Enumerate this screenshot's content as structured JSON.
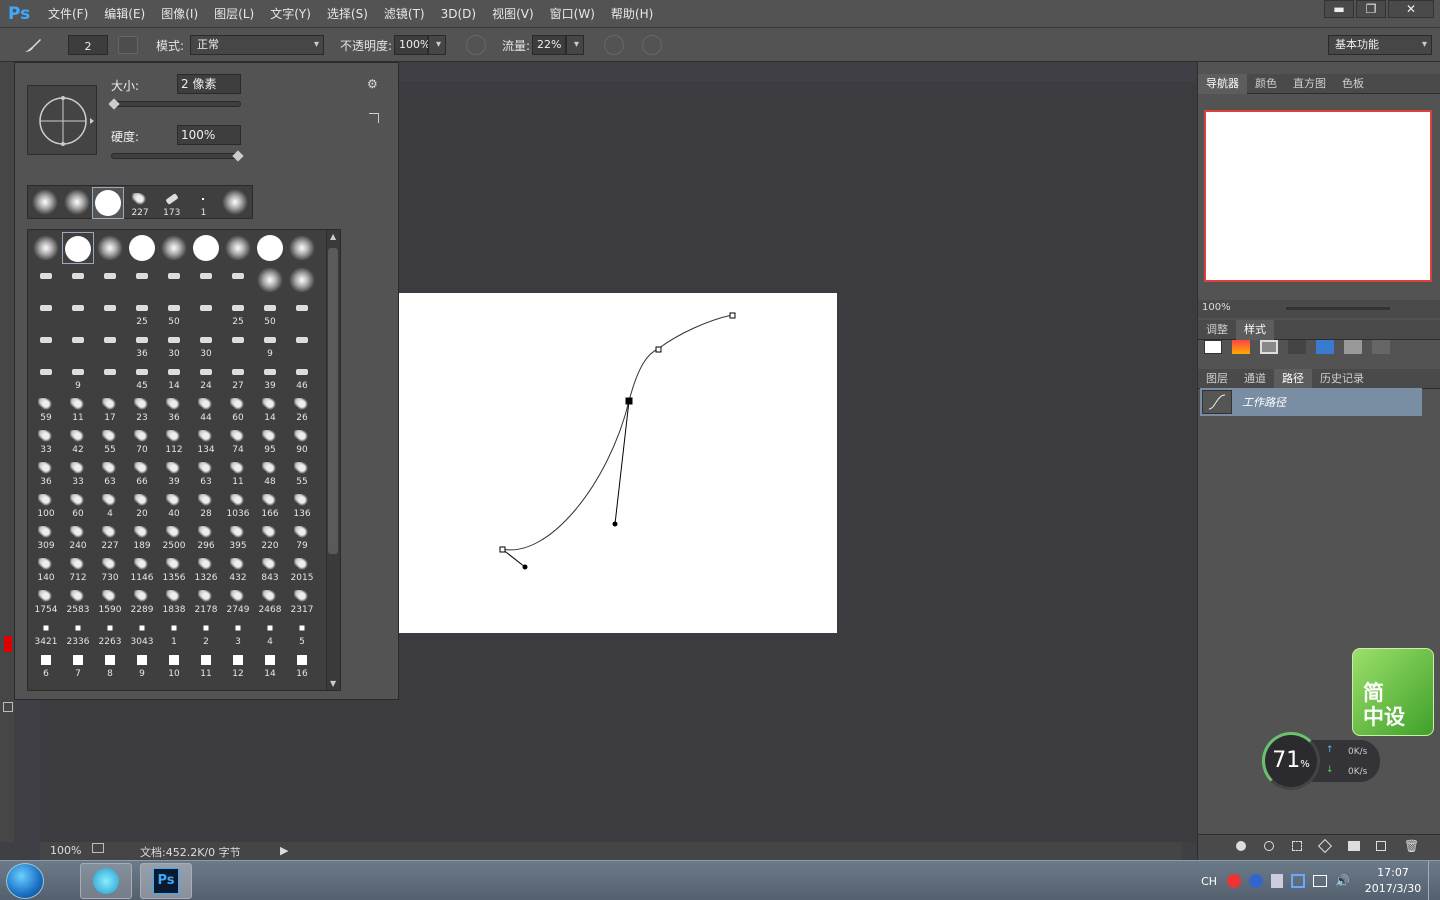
{
  "app": {
    "logo": "Ps"
  },
  "menu": [
    "文件(F)",
    "编辑(E)",
    "图像(I)",
    "图层(L)",
    "文字(Y)",
    "选择(S)",
    "滤镜(T)",
    "3D(D)",
    "视图(V)",
    "窗口(W)",
    "帮助(H)"
  ],
  "window_controls": {
    "minimize": "▬",
    "restore": "❐",
    "close": "✕"
  },
  "options": {
    "brush_size": "2",
    "mode_label": "模式:",
    "mode_value": "正常",
    "opacity_label": "不透明度:",
    "opacity_value": "100%",
    "flow_label": "流量:",
    "flow_value": "22%",
    "workspace": "基本功能"
  },
  "brush_panel": {
    "size_label": "大小:",
    "size_value": "2 像素",
    "hardness_label": "硬度:",
    "hardness_value": "100%",
    "size_fraction": 0.01,
    "hardness_fraction": 1.0,
    "recent_numbers": [
      "",
      "",
      "",
      "227",
      "173",
      "1",
      ""
    ],
    "grid_numbers": [
      "",
      "",
      "",
      "",
      "",
      "",
      "",
      "",
      "",
      "",
      "",
      "",
      "",
      "",
      "",
      "",
      "",
      "",
      "",
      "",
      "",
      "25",
      "50",
      "",
      "25",
      "50",
      "",
      "",
      "",
      "",
      "36",
      "30",
      "30",
      "",
      "9",
      "",
      "",
      "9",
      "",
      "45",
      "14",
      "24",
      "27",
      "39",
      "46",
      "59",
      "11",
      "17",
      "23",
      "36",
      "44",
      "60",
      "14",
      "26",
      "33",
      "42",
      "55",
      "70",
      "112",
      "134",
      "74",
      "95",
      "90",
      "36",
      "33",
      "63",
      "66",
      "39",
      "63",
      "11",
      "48",
      "55",
      "100",
      "60",
      "4",
      "20",
      "40",
      "28",
      "1036",
      "166",
      "136",
      "309",
      "240",
      "227",
      "189",
      "2500",
      "296",
      "395",
      "220",
      "79",
      "140",
      "712",
      "730",
      "1146",
      "1356",
      "1326",
      "432",
      "843",
      "2015",
      "1754",
      "2583",
      "1590",
      "2289",
      "1838",
      "2178",
      "2749",
      "2468",
      "2317",
      "3421",
      "2336",
      "2263",
      "3043",
      "1",
      "2",
      "3",
      "4",
      "5",
      "6",
      "7",
      "8",
      "9",
      "10",
      "11",
      "12",
      "14",
      "16"
    ]
  },
  "right": {
    "nav_tabs": [
      "导航器",
      "颜色",
      "直方图",
      "色板"
    ],
    "nav_zoom": "100%",
    "adjust_tabs": [
      "调整",
      "样式"
    ],
    "layer_tabs": [
      "图层",
      "通道",
      "路径",
      "历史记录"
    ],
    "path_name": "工作路径"
  },
  "status": {
    "zoom": "100%",
    "doc": "文档:452.2K/0 字节"
  },
  "taskbar": {
    "ime": "CH",
    "time": "17:07",
    "date": "2017/3/30"
  },
  "widgets": {
    "green_line1": "简",
    "green_line2": "中设",
    "speed_percent": "71",
    "speed_unit": "%",
    "up": "0K/s",
    "down": "0K/s"
  }
}
